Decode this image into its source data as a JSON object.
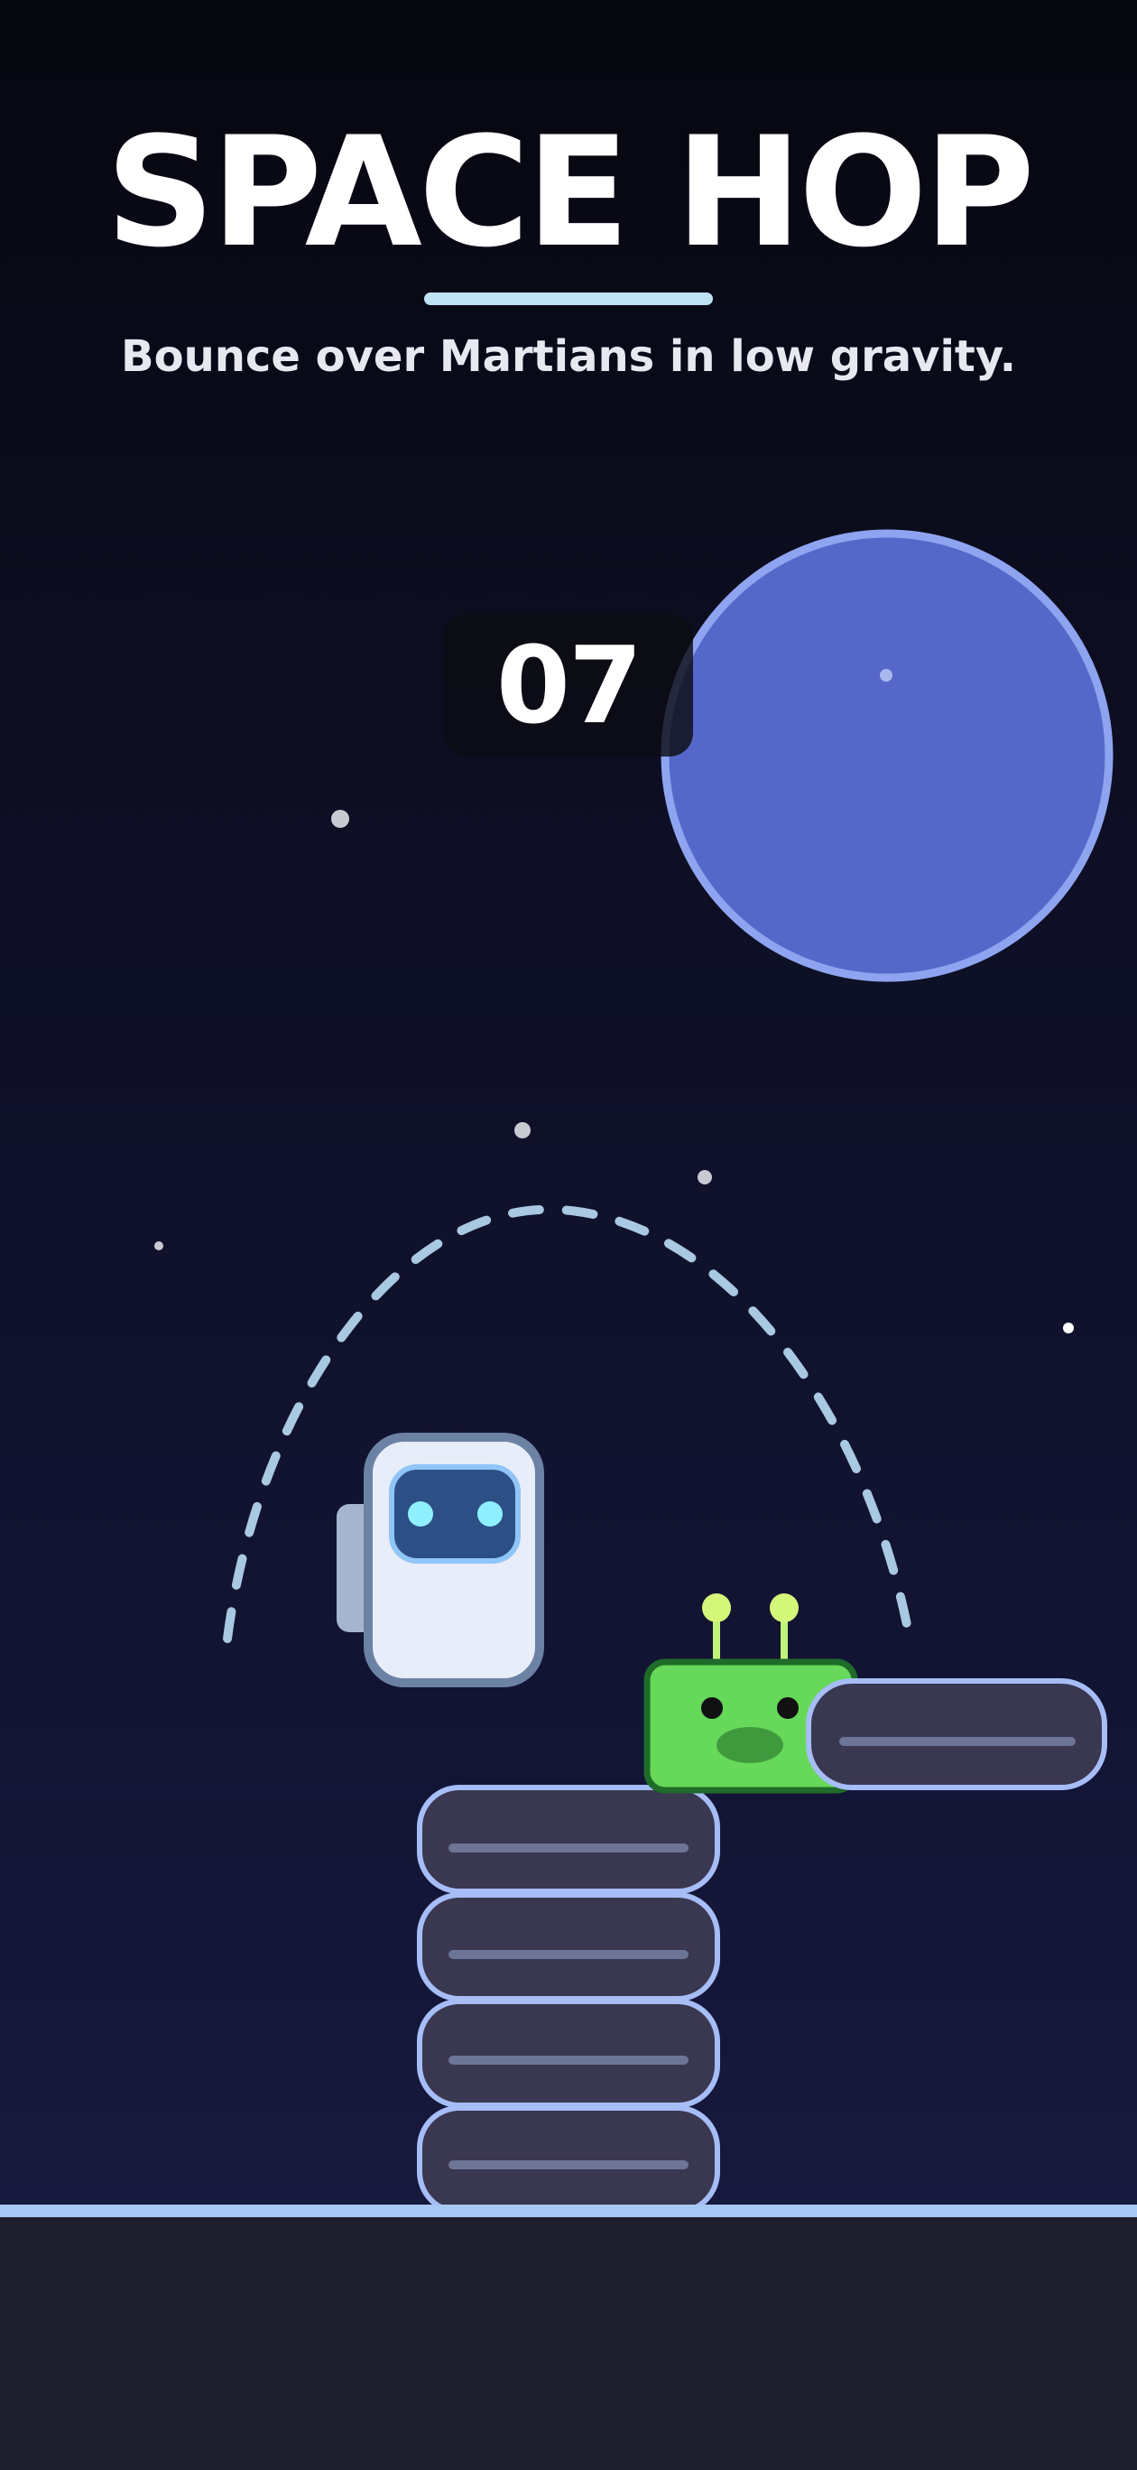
{
  "game": {
    "title": "SPACE HOP",
    "subtitle": "Bounce over Martians in low gravity.",
    "score": "07"
  },
  "colors": {
    "background_top": "#06070f",
    "background_bottom": "#181a42",
    "title_text": "#ffffff",
    "title_underline": "#bfe2f5",
    "planet_fill": "#5568c9",
    "planet_outline": "#8ea4f0",
    "platform_fill": "#3a3750",
    "platform_outline": "#a6bdf7",
    "platform_stripe": "#6d7596",
    "martian_body": "#66d85a",
    "martian_outline": "#1f6b2a",
    "martian_antenna_tip": "#d4f77a",
    "astronaut_suit": "#e8edfa",
    "astronaut_outline": "#6c82a5",
    "astronaut_visor": "#2c4f86",
    "astronaut_eyes": "#8ef0ff",
    "jump_path": "#a9c8e2",
    "ground_fill": "#201f2e",
    "ground_edge": "#a6c8f3"
  },
  "icons": {
    "player": "astronaut-icon",
    "enemy": "martian-icon",
    "planet": "planet-icon"
  }
}
